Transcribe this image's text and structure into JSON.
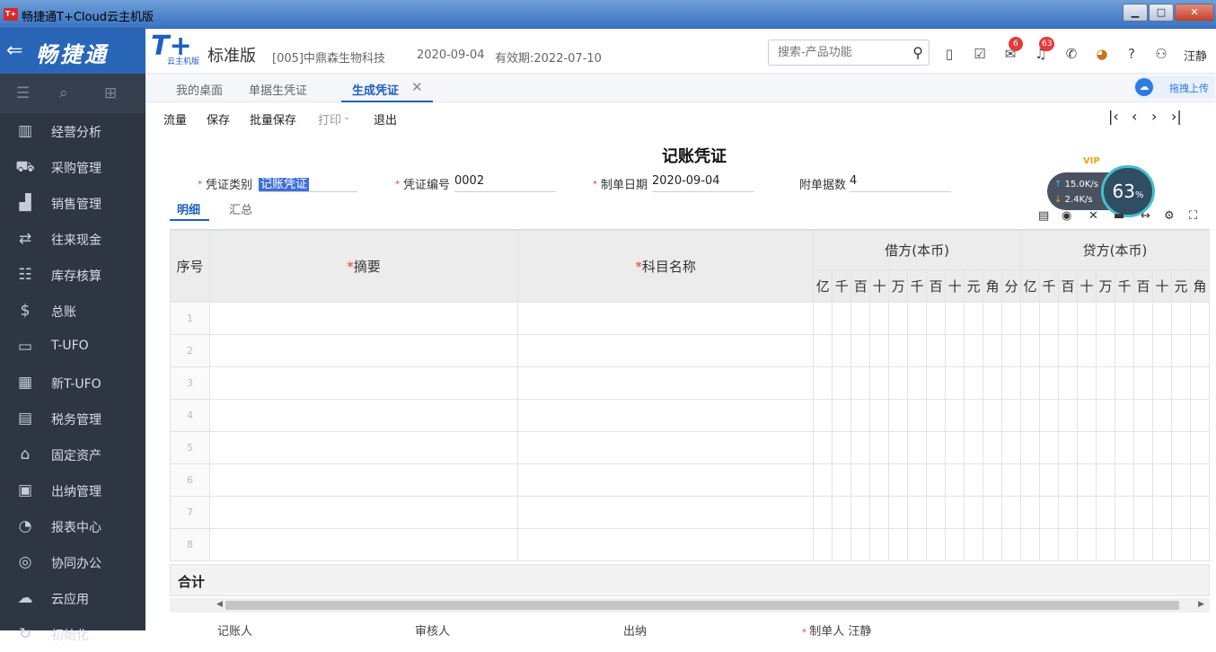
{
  "window": {
    "title": "畅捷通T+Cloud云主机版",
    "app_icon": "T+"
  },
  "brand": {
    "name": "畅捷通",
    "product": "T+",
    "product_sub": "云主机版",
    "edition": "标准版",
    "company": "[005]中鼎森生物科技",
    "date": "2020-09-04",
    "expiry": "有效期:2022-07-10"
  },
  "search": {
    "placeholder": "搜索-产品功能"
  },
  "header_icons": {
    "messages_badge": "6",
    "notifications_badge": "63",
    "user": "汪静"
  },
  "sidebar": {
    "items": [
      {
        "label": "经营分析",
        "icon": "chart-icon"
      },
      {
        "label": "采购管理",
        "icon": "cart-icon"
      },
      {
        "label": "销售管理",
        "icon": "sales-icon"
      },
      {
        "label": "往来现金",
        "icon": "exchange-icon"
      },
      {
        "label": "库存核算",
        "icon": "inventory-icon"
      },
      {
        "label": "总账",
        "icon": "ledger-icon"
      },
      {
        "label": "T-UFO",
        "icon": "ufo-icon"
      },
      {
        "label": "新T-UFO",
        "icon": "new-ufo-icon"
      },
      {
        "label": "税务管理",
        "icon": "tax-icon"
      },
      {
        "label": "固定资产",
        "icon": "bank-icon"
      },
      {
        "label": "出纳管理",
        "icon": "cashier-icon"
      },
      {
        "label": "报表中心",
        "icon": "pie-icon"
      },
      {
        "label": "协同办公",
        "icon": "collab-icon"
      },
      {
        "label": "云应用",
        "icon": "cloud-icon"
      },
      {
        "label": "初始化",
        "icon": "init-icon"
      }
    ]
  },
  "tabs": [
    {
      "label": "我的桌面"
    },
    {
      "label": "单据生凭证"
    },
    {
      "label": "生成凭证"
    }
  ],
  "upload": {
    "label": "拖拽上传"
  },
  "toolbar": {
    "flow": "流量",
    "save": "保存",
    "batch_save": "批量保存",
    "print": "打印",
    "exit": "退出"
  },
  "voucher": {
    "title": "记账凭证",
    "type_label": "凭证类别",
    "type_value": "记账凭证",
    "no_label": "凭证编号",
    "no_value": "0002",
    "date_label": "制单日期",
    "date_value": "2020-09-04",
    "attach_label": "附单据数",
    "attach_value": "4"
  },
  "subtabs": {
    "detail": "明细",
    "summary": "汇总"
  },
  "speed": {
    "up": "15.0K/s",
    "down": "2.4K/s",
    "percent": "63",
    "percent_unit": "%",
    "vip": "VIP"
  },
  "table": {
    "col_seq": "序号",
    "col_summary": "摘要",
    "col_account": "科目名称",
    "col_debit": "借方(本币)",
    "col_credit": "贷方(本币)",
    "debit_digits": [
      "亿",
      "千",
      "百",
      "十",
      "万",
      "千",
      "百",
      "十",
      "元",
      "角",
      "分"
    ],
    "credit_digits": [
      "亿",
      "千",
      "百",
      "十",
      "万",
      "千",
      "百",
      "十",
      "元",
      "角"
    ],
    "rows": [
      "1",
      "2",
      "3",
      "4",
      "5",
      "6",
      "7",
      "8"
    ],
    "total_label": "合计"
  },
  "signatures": {
    "bookkeeper": "记账人",
    "auditor": "审核人",
    "cashier": "出纳",
    "maker_label": "制单人",
    "maker": "汪静"
  }
}
